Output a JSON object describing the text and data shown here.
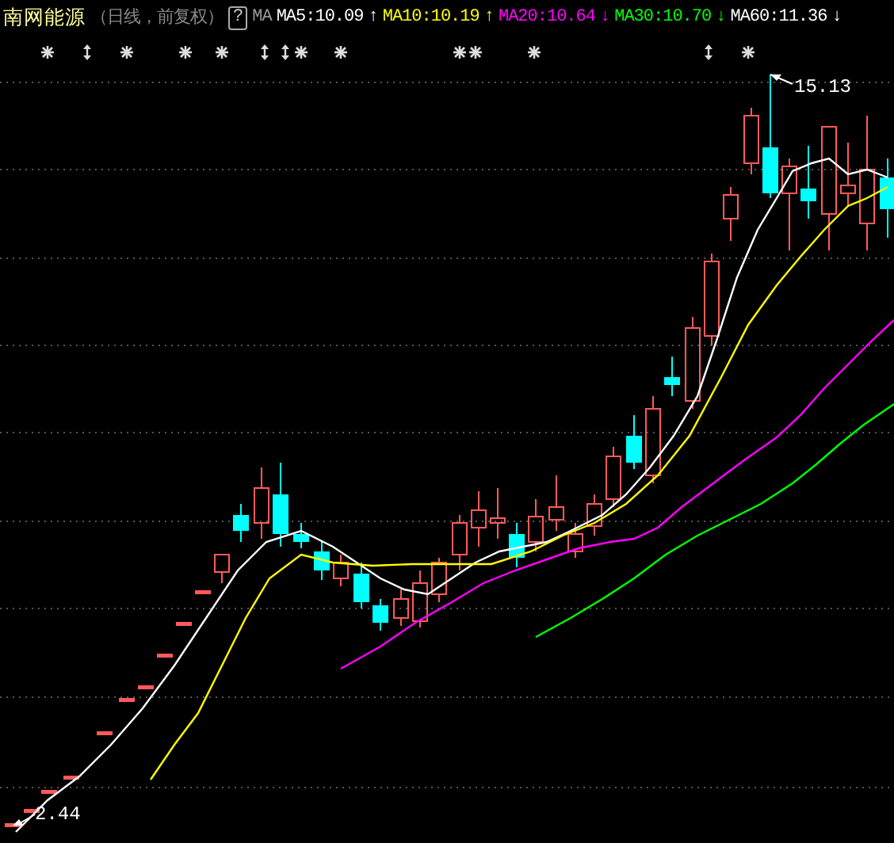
{
  "header": {
    "stock_name": "南网能源",
    "period": "（日线，前复权）",
    "help": "?",
    "indicator": "MA",
    "averages": [
      {
        "label": "MA5:10.09",
        "arrow": "↑",
        "color": "#ffffff"
      },
      {
        "label": "MA10:10.19",
        "arrow": "↑",
        "color": "#ffff00"
      },
      {
        "label": "MA20:10.64",
        "arrow": "↓",
        "color": "#ff00ff"
      },
      {
        "label": "MA30:10.70",
        "arrow": "↓",
        "color": "#00ff00"
      },
      {
        "label": "MA60:11.36",
        "arrow": "↓",
        "color": "#ffffff"
      }
    ]
  },
  "signal_marks": [
    {
      "kind": "star"
    },
    {
      "kind": "updown"
    },
    {
      "kind": "star"
    },
    {
      "kind": "star"
    },
    {
      "kind": "star"
    },
    {
      "kind": "updown"
    },
    {
      "kind": "updown"
    },
    {
      "kind": "star"
    },
    {
      "kind": "star"
    },
    {
      "kind": "star"
    },
    {
      "kind": "star"
    },
    {
      "kind": "star"
    },
    {
      "kind": "updown"
    },
    {
      "kind": "star"
    }
  ],
  "annotations": [
    {
      "kind": "high",
      "label": "15.13"
    },
    {
      "kind": "low",
      "label": "2.44"
    }
  ]
}
